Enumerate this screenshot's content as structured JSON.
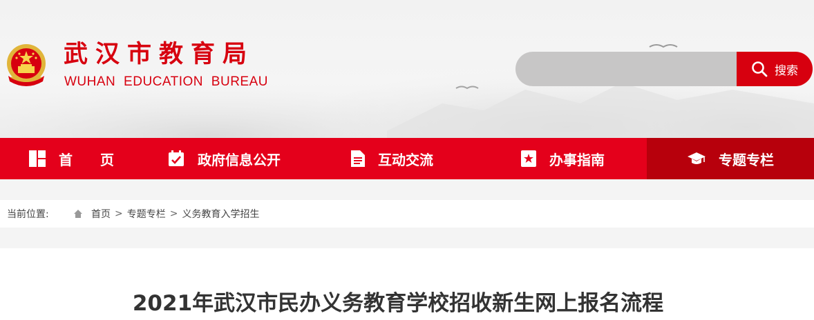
{
  "header": {
    "logo_cn": "武汉市教育局",
    "logo_en": "WUHAN EDUCATION BUREAU",
    "search": {
      "placeholder": "",
      "button_label": "搜索"
    }
  },
  "nav": {
    "items": [
      {
        "label": "首　　页",
        "icon": "grid-icon",
        "active": false
      },
      {
        "label": "政府信息公开",
        "icon": "calendar-check-icon",
        "active": false
      },
      {
        "label": "互动交流",
        "icon": "document-icon",
        "active": false
      },
      {
        "label": "办事指南",
        "icon": "bookmark-star-icon",
        "active": false
      },
      {
        "label": "专题专栏",
        "icon": "graduation-cap-icon",
        "active": true
      }
    ]
  },
  "breadcrumb": {
    "label": "当前位置:",
    "items": [
      "首页",
      "专题专栏",
      "义务教育入学招生"
    ],
    "separator": ">"
  },
  "article": {
    "title": "2021年武汉市民办义务教育学校招收新生网上报名流程"
  },
  "colors": {
    "brand_red": "#d7000f",
    "nav_red": "#e4001b",
    "nav_active": "#b7000c"
  }
}
